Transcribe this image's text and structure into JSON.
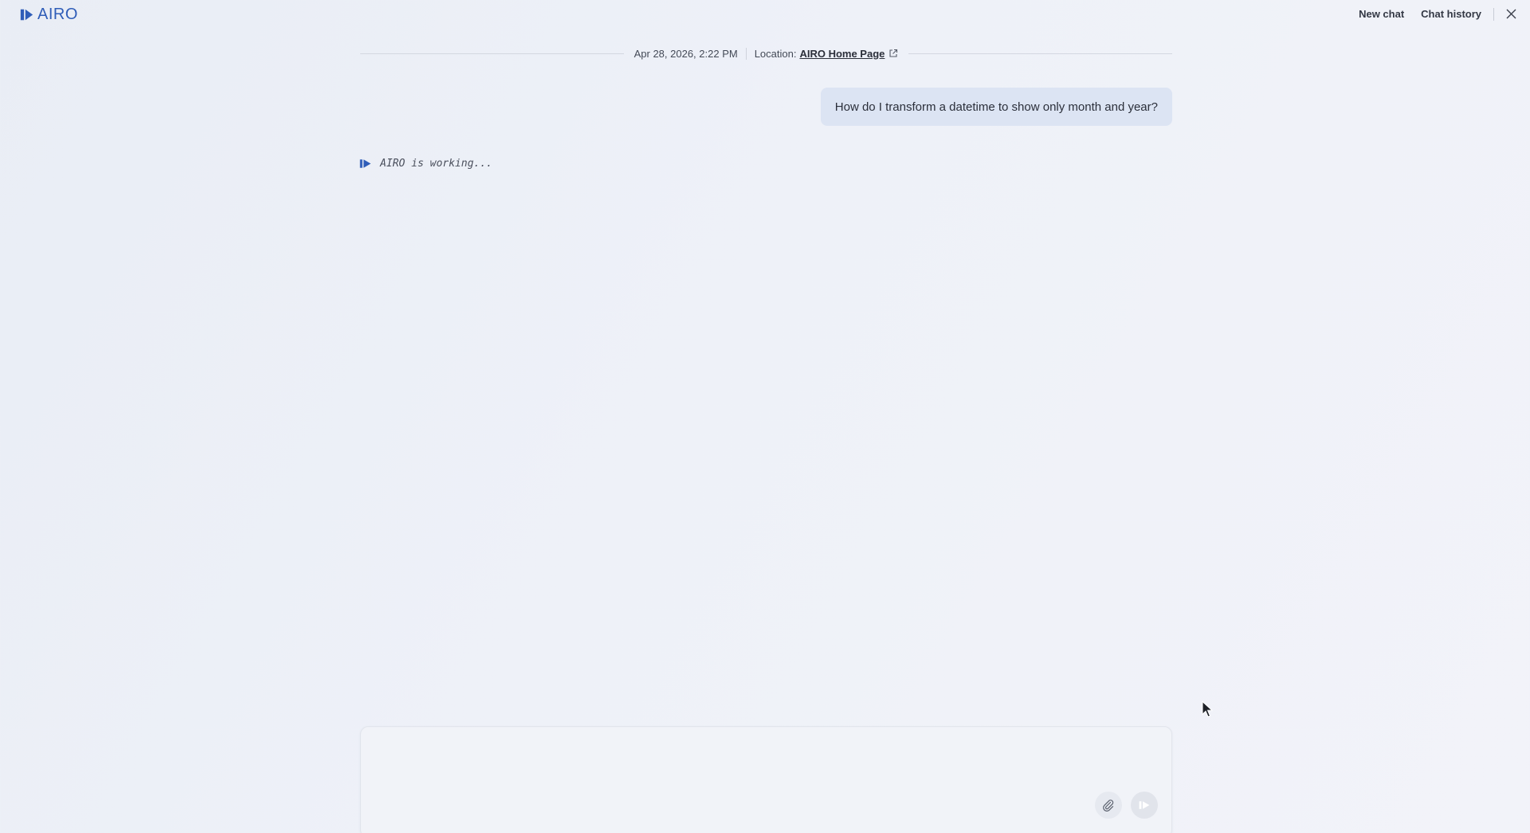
{
  "app": {
    "brand_name": "AIRO",
    "logo_icon": "airo-logo-icon",
    "accent_color": "#2f5db8"
  },
  "header": {
    "new_chat_label": "New chat",
    "chat_history_label": "Chat history",
    "close_icon": "close-icon"
  },
  "conversation": {
    "timestamp": "Apr 28, 2026, 2:22 PM",
    "location_label": "Location:",
    "location_link": "AIRO Home Page",
    "location_link_icon": "external-link-icon",
    "user_message": "How do I transform a datetime to show only month and year?",
    "status_text": "AIRO is working..."
  },
  "composer": {
    "input_value": "",
    "attach_icon": "paperclip-icon",
    "send_icon": "send-icon"
  }
}
